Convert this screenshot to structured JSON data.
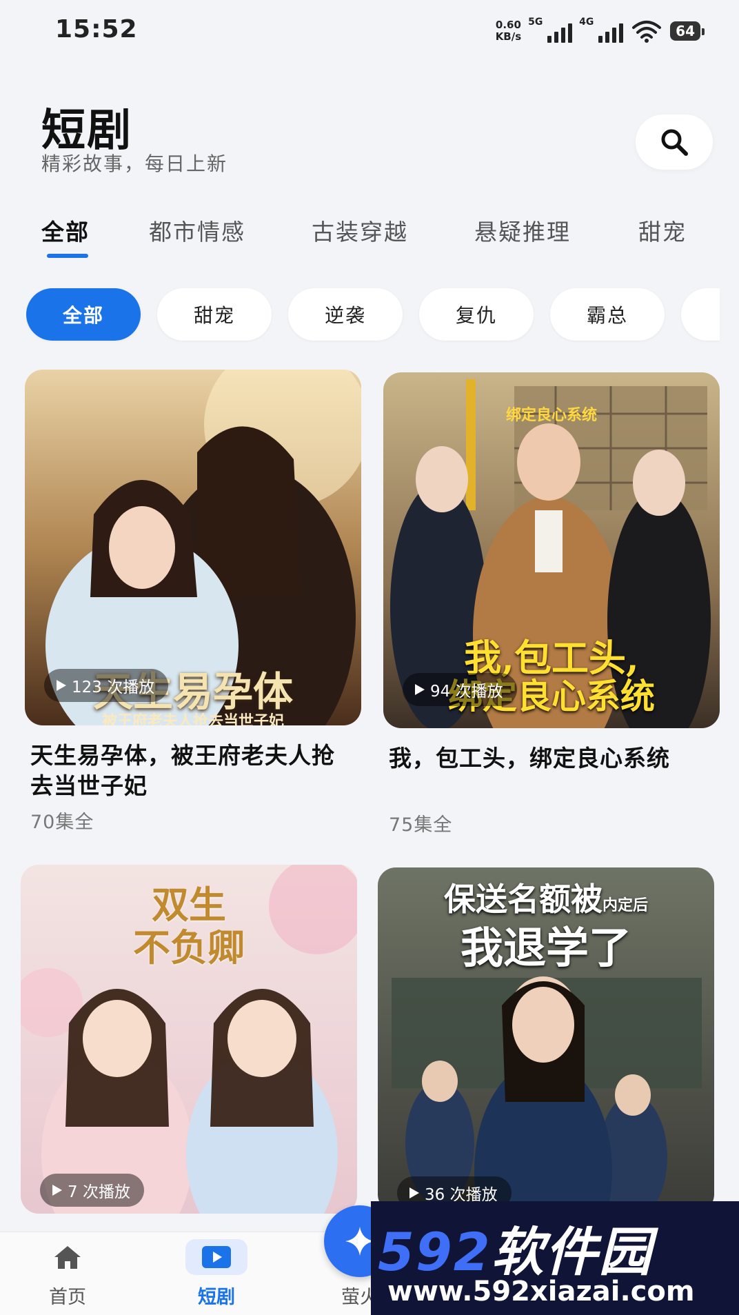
{
  "status_bar": {
    "time": "15:52",
    "net_speed_value": "0.60",
    "net_speed_unit": "KB/s",
    "sim1": "5G",
    "sim2": "4G",
    "battery": "64"
  },
  "header": {
    "title": "短剧",
    "subtitle": "精彩故事，每日上新",
    "search_icon": "search-icon"
  },
  "tabs": [
    {
      "label": "全部",
      "active": true
    },
    {
      "label": "都市情感",
      "active": false
    },
    {
      "label": "古装穿越",
      "active": false
    },
    {
      "label": "悬疑推理",
      "active": false
    },
    {
      "label": "甜宠",
      "active": false
    }
  ],
  "chips": [
    {
      "label": "全部",
      "active": true
    },
    {
      "label": "甜宠",
      "active": false
    },
    {
      "label": "逆袭",
      "active": false
    },
    {
      "label": "复仇",
      "active": false
    },
    {
      "label": "霸总",
      "active": false
    }
  ],
  "cards": [
    {
      "poster_title": "天生易孕体",
      "poster_subtitle": "被王府老夫人抢去当世子妃",
      "plays": "123 次播放",
      "title": "天生易孕体，被王府老夫人抢去当世子妃",
      "episodes": "70集全"
    },
    {
      "poster_title": "我,包工头,",
      "poster_title2": "绑定良心系统",
      "poster_top": "绑定良心系统",
      "plays": "94 次播放",
      "title": "我，包工头，绑定良心系统",
      "episodes": "75集全"
    },
    {
      "poster_title": "双生",
      "poster_title2": "不负卿",
      "plays": "7 次播放"
    },
    {
      "poster_title": "保送名额被",
      "poster_title_small": "内定后",
      "poster_title2": "我退学了",
      "plays": "36 次播放"
    }
  ],
  "bottom_nav": [
    {
      "label": "首页",
      "icon": "home-icon",
      "active": false
    },
    {
      "label": "短剧",
      "icon": "play-icon",
      "active": true
    },
    {
      "label": "萤火",
      "icon": "sparkle-icon",
      "active": false
    }
  ],
  "watermark": {
    "logo_num": "592",
    "logo_text": "软件园",
    "url": "www.592xiazai.com"
  },
  "colors": {
    "accent": "#1a73e8",
    "background": "#f3f4f8"
  }
}
